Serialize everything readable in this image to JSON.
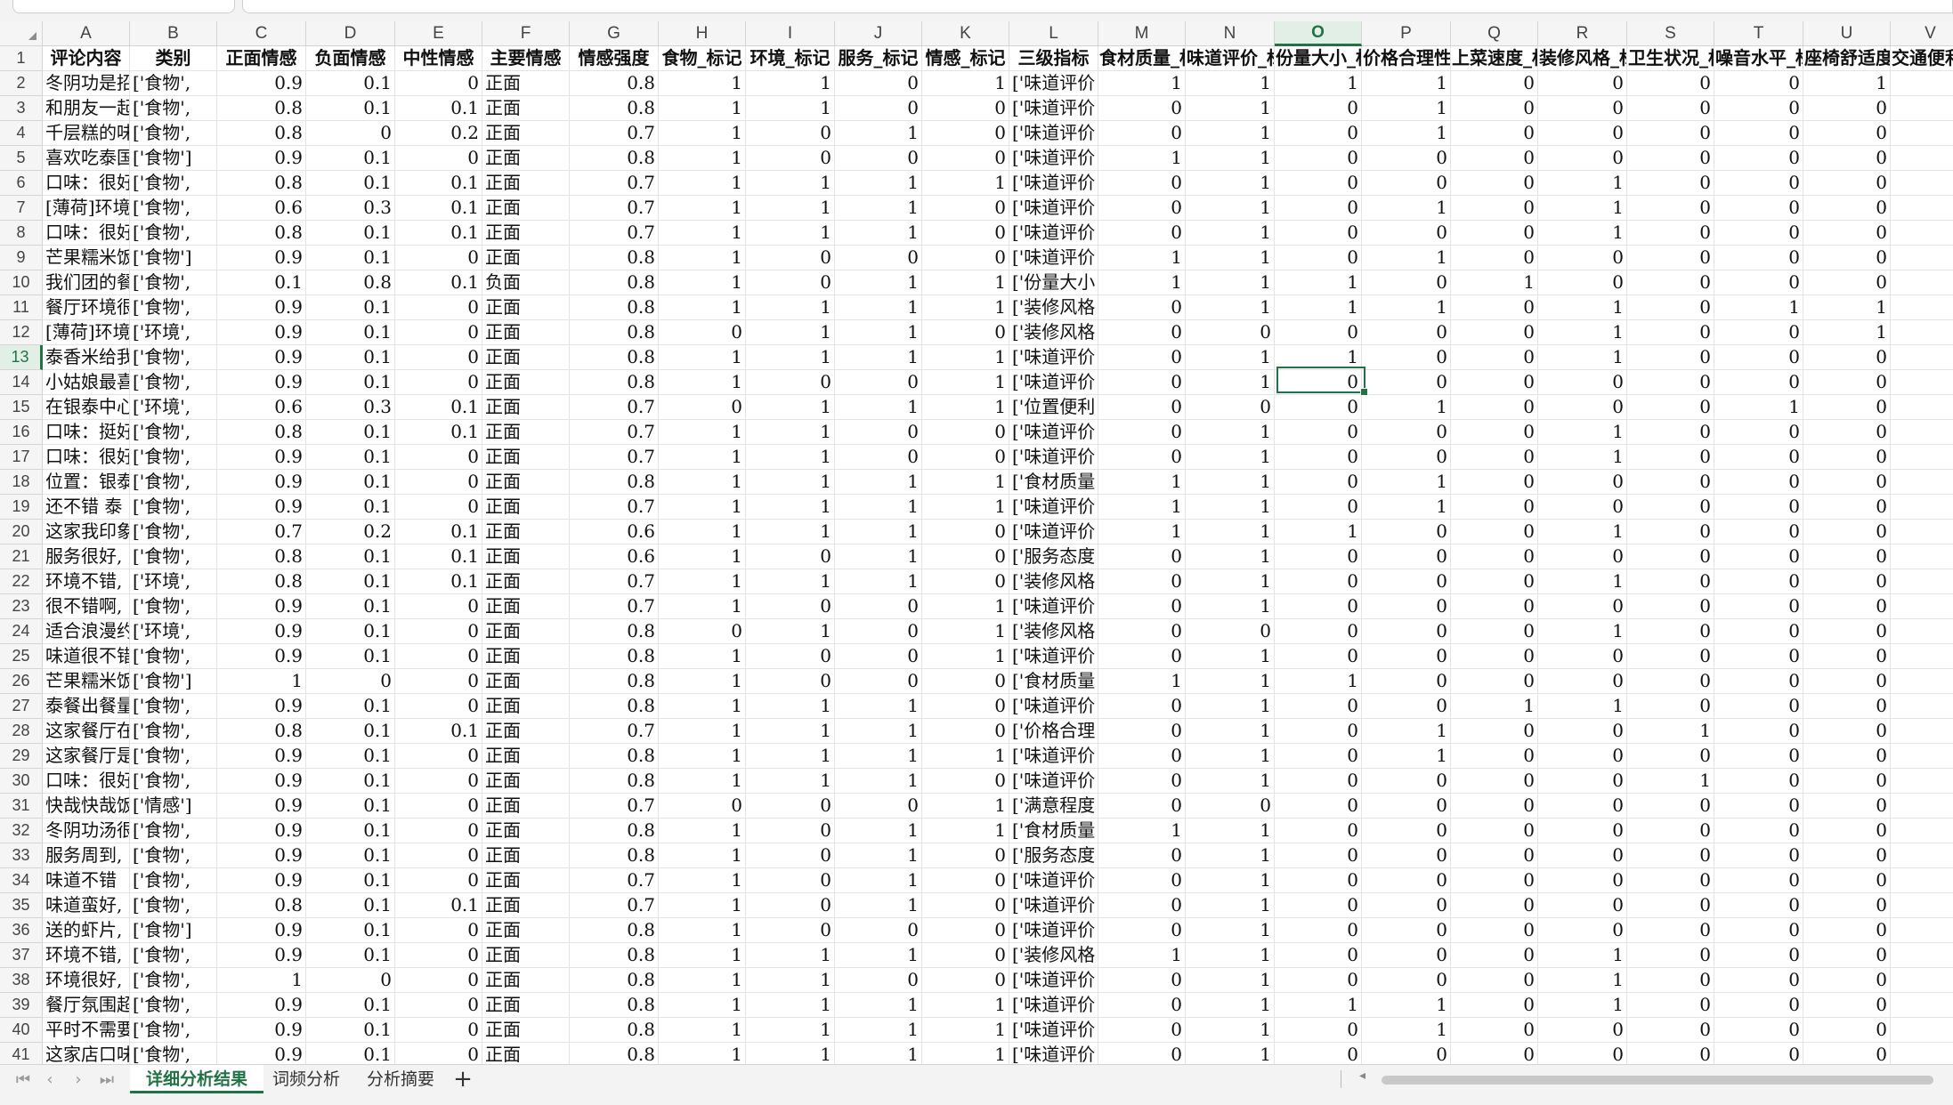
{
  "sheet": {
    "columns": [
      "A",
      "B",
      "C",
      "D",
      "E",
      "F",
      "G",
      "H",
      "I",
      "J",
      "K",
      "L",
      "M",
      "N",
      "O",
      "P",
      "Q",
      "R",
      "S",
      "T",
      "U",
      "V"
    ],
    "selected_column": "O",
    "selected_row": "13",
    "header_row": [
      "评论内容",
      "类别",
      "正面情感",
      "负面情感",
      "中性情感",
      "主要情感",
      "情感强度",
      "食物_标记",
      "环境_标记",
      "服务_标记",
      "情感_标记",
      "三级指标",
      "食材质量_标",
      "味道评价_标",
      "份量大小_标",
      "价格合理性_",
      "上菜速度_标",
      "装修风格_标",
      "卫生状况_标",
      "噪音水平_标",
      "座椅舒适度_",
      "交通便利性"
    ],
    "rows": [
      [
        "1",
        [
          "评论内容",
          "类别",
          "正面情感",
          "负面情感",
          "中性情感",
          "主要情感",
          "情感强度",
          "食物_标记",
          "环境_标记",
          "服务_标记",
          "情感_标记",
          "三级指标",
          "食材质量_标",
          "味道评价_标",
          "份量大小_标",
          "价格合理性_",
          "上菜速度_标",
          "装修风格_标",
          "卫生状况_标",
          "噪音水平_标",
          "座椅舒适度_",
          "交通便利性"
        ]
      ],
      [
        "2",
        [
          "冬阴功是招",
          "['食物',",
          "0.9",
          "0.1",
          "0",
          "正面",
          "0.8",
          "1",
          "1",
          "0",
          "1",
          "['味道评价",
          "1",
          "1",
          "1",
          "1",
          "0",
          "0",
          "0",
          "0",
          "1",
          ""
        ]
      ],
      [
        "3",
        [
          "和朋友一起",
          "['食物',",
          "0.8",
          "0.1",
          "0.1",
          "正面",
          "0.8",
          "1",
          "1",
          "0",
          "0",
          "['味道评价",
          "0",
          "1",
          "0",
          "1",
          "0",
          "0",
          "0",
          "0",
          "0",
          ""
        ]
      ],
      [
        "4",
        [
          "千层糕的味",
          "['食物',",
          "0.8",
          "0",
          "0.2",
          "正面",
          "0.7",
          "1",
          "0",
          "1",
          "0",
          "['味道评价",
          "0",
          "1",
          "0",
          "1",
          "0",
          "0",
          "0",
          "0",
          "0",
          ""
        ]
      ],
      [
        "5",
        [
          "喜欢吃泰国",
          "['食物']",
          "0.9",
          "0.1",
          "0",
          "正面",
          "0.8",
          "1",
          "0",
          "0",
          "0",
          "['味道评价",
          "1",
          "1",
          "0",
          "0",
          "0",
          "0",
          "0",
          "0",
          "0",
          ""
        ]
      ],
      [
        "6",
        [
          "口味：很好",
          "['食物',",
          "0.8",
          "0.1",
          "0.1",
          "正面",
          "0.7",
          "1",
          "1",
          "1",
          "1",
          "['味道评价",
          "0",
          "1",
          "0",
          "0",
          "0",
          "1",
          "0",
          "0",
          "0",
          ""
        ]
      ],
      [
        "7",
        [
          "[薄荷]环境",
          "['食物',",
          "0.6",
          "0.3",
          "0.1",
          "正面",
          "0.7",
          "1",
          "1",
          "1",
          "0",
          "['味道评价",
          "0",
          "1",
          "0",
          "1",
          "0",
          "1",
          "0",
          "0",
          "0",
          ""
        ]
      ],
      [
        "8",
        [
          "口味：很好",
          "['食物',",
          "0.8",
          "0.1",
          "0.1",
          "正面",
          "0.7",
          "1",
          "1",
          "1",
          "0",
          "['味道评价",
          "0",
          "1",
          "0",
          "0",
          "0",
          "1",
          "0",
          "0",
          "0",
          ""
        ]
      ],
      [
        "9",
        [
          "芒果糯米饭",
          "['食物']",
          "0.9",
          "0.1",
          "0",
          "正面",
          "0.8",
          "1",
          "0",
          "0",
          "0",
          "['味道评价",
          "1",
          "1",
          "0",
          "1",
          "0",
          "0",
          "0",
          "0",
          "0",
          ""
        ]
      ],
      [
        "10",
        [
          "我们团的餐",
          "['食物',",
          "0.1",
          "0.8",
          "0.1",
          "负面",
          "0.8",
          "1",
          "0",
          "1",
          "1",
          "['份量大小",
          "1",
          "1",
          "1",
          "0",
          "1",
          "0",
          "0",
          "0",
          "0",
          ""
        ]
      ],
      [
        "11",
        [
          "餐厅环境很",
          "['食物',",
          "0.9",
          "0.1",
          "0",
          "正面",
          "0.8",
          "1",
          "1",
          "1",
          "1",
          "['装修风格",
          "0",
          "1",
          "1",
          "1",
          "0",
          "1",
          "0",
          "1",
          "1",
          ""
        ]
      ],
      [
        "12",
        [
          "[薄荷]环境",
          "['环境',",
          "0.9",
          "0.1",
          "0",
          "正面",
          "0.8",
          "0",
          "1",
          "1",
          "0",
          "['装修风格",
          "0",
          "0",
          "0",
          "0",
          "0",
          "1",
          "0",
          "0",
          "1",
          ""
        ]
      ],
      [
        "13",
        [
          "泰香米给我",
          "['食物',",
          "0.9",
          "0.1",
          "0",
          "正面",
          "0.8",
          "1",
          "1",
          "1",
          "1",
          "['味道评价",
          "0",
          "1",
          "1",
          "0",
          "0",
          "1",
          "0",
          "0",
          "0",
          ""
        ]
      ],
      [
        "14",
        [
          "小姑娘最喜",
          "['食物',",
          "0.9",
          "0.1",
          "0",
          "正面",
          "0.8",
          "1",
          "0",
          "0",
          "1",
          "['味道评价",
          "0",
          "1",
          "0",
          "0",
          "0",
          "0",
          "0",
          "0",
          "0",
          ""
        ]
      ],
      [
        "15",
        [
          "在银泰中心",
          "['环境',",
          "0.6",
          "0.3",
          "0.1",
          "正面",
          "0.7",
          "0",
          "1",
          "1",
          "1",
          "['位置便利",
          "0",
          "0",
          "0",
          "1",
          "0",
          "0",
          "0",
          "1",
          "0",
          ""
        ]
      ],
      [
        "16",
        [
          "口味：挺好",
          "['食物',",
          "0.8",
          "0.1",
          "0.1",
          "正面",
          "0.7",
          "1",
          "1",
          "0",
          "0",
          "['味道评价",
          "0",
          "1",
          "0",
          "0",
          "0",
          "1",
          "0",
          "0",
          "0",
          ""
        ]
      ],
      [
        "17",
        [
          "口味：很好",
          "['食物',",
          "0.9",
          "0.1",
          "0",
          "正面",
          "0.7",
          "1",
          "1",
          "0",
          "0",
          "['味道评价",
          "0",
          "1",
          "0",
          "0",
          "0",
          "1",
          "0",
          "0",
          "0",
          ""
        ]
      ],
      [
        "18",
        [
          "位置：银泰",
          "['食物',",
          "0.9",
          "0.1",
          "0",
          "正面",
          "0.8",
          "1",
          "1",
          "1",
          "1",
          "['食材质量",
          "1",
          "1",
          "0",
          "1",
          "0",
          "0",
          "0",
          "0",
          "0",
          ""
        ]
      ],
      [
        "19",
        [
          "还不错 泰",
          "['食物',",
          "0.9",
          "0.1",
          "0",
          "正面",
          "0.7",
          "1",
          "1",
          "1",
          "1",
          "['味道评价",
          "1",
          "1",
          "0",
          "1",
          "0",
          "0",
          "0",
          "0",
          "0",
          ""
        ]
      ],
      [
        "20",
        [
          "这家我印象",
          "['食物',",
          "0.7",
          "0.2",
          "0.1",
          "正面",
          "0.6",
          "1",
          "1",
          "1",
          "0",
          "['味道评价",
          "1",
          "1",
          "1",
          "0",
          "0",
          "1",
          "0",
          "0",
          "0",
          ""
        ]
      ],
      [
        "21",
        [
          "服务很好,",
          "['食物',",
          "0.8",
          "0.1",
          "0.1",
          "正面",
          "0.6",
          "1",
          "0",
          "1",
          "0",
          "['服务态度",
          "0",
          "1",
          "0",
          "0",
          "0",
          "0",
          "0",
          "0",
          "0",
          ""
        ]
      ],
      [
        "22",
        [
          "环境不错,",
          "['环境',",
          "0.8",
          "0.1",
          "0.1",
          "正面",
          "0.7",
          "1",
          "1",
          "1",
          "0",
          "['装修风格",
          "0",
          "1",
          "0",
          "0",
          "0",
          "1",
          "0",
          "0",
          "0",
          ""
        ]
      ],
      [
        "23",
        [
          "很不错啊,",
          "['食物',",
          "0.9",
          "0.1",
          "0",
          "正面",
          "0.7",
          "1",
          "0",
          "0",
          "1",
          "['味道评价",
          "0",
          "1",
          "0",
          "0",
          "0",
          "0",
          "0",
          "0",
          "0",
          ""
        ]
      ],
      [
        "24",
        [
          "适合浪漫约",
          "['环境',",
          "0.9",
          "0.1",
          "0",
          "正面",
          "0.8",
          "0",
          "1",
          "0",
          "1",
          "['装修风格",
          "0",
          "0",
          "0",
          "0",
          "0",
          "1",
          "0",
          "0",
          "0",
          ""
        ]
      ],
      [
        "25",
        [
          "味道很不错",
          "['食物',",
          "0.9",
          "0.1",
          "0",
          "正面",
          "0.8",
          "1",
          "0",
          "0",
          "1",
          "['味道评价",
          "0",
          "1",
          "0",
          "0",
          "0",
          "0",
          "0",
          "0",
          "0",
          ""
        ]
      ],
      [
        "26",
        [
          "芒果糯米饭",
          "['食物']",
          "1",
          "0",
          "0",
          "正面",
          "0.8",
          "1",
          "0",
          "0",
          "0",
          "['食材质量",
          "1",
          "1",
          "1",
          "0",
          "0",
          "0",
          "0",
          "0",
          "0",
          ""
        ]
      ],
      [
        "27",
        [
          "泰餐出餐量",
          "['食物',",
          "0.9",
          "0.1",
          "0",
          "正面",
          "0.8",
          "1",
          "1",
          "1",
          "0",
          "['味道评价",
          "0",
          "1",
          "0",
          "0",
          "1",
          "1",
          "0",
          "0",
          "0",
          ""
        ]
      ],
      [
        "28",
        [
          "这家餐厅在",
          "['食物',",
          "0.8",
          "0.1",
          "0.1",
          "正面",
          "0.7",
          "1",
          "1",
          "1",
          "0",
          "['价格合理",
          "0",
          "1",
          "0",
          "1",
          "0",
          "0",
          "1",
          "0",
          "0",
          ""
        ]
      ],
      [
        "29",
        [
          "这家餐厅是",
          "['食物',",
          "0.9",
          "0.1",
          "0",
          "正面",
          "0.8",
          "1",
          "1",
          "1",
          "1",
          "['味道评价",
          "0",
          "1",
          "0",
          "1",
          "0",
          "0",
          "0",
          "0",
          "0",
          ""
        ]
      ],
      [
        "30",
        [
          "口味：很好",
          "['食物',",
          "0.9",
          "0.1",
          "0",
          "正面",
          "0.8",
          "1",
          "1",
          "1",
          "0",
          "['味道评价",
          "0",
          "1",
          "0",
          "0",
          "0",
          "0",
          "1",
          "0",
          "0",
          ""
        ]
      ],
      [
        "31",
        [
          "快哉快哉饭",
          "['情感']",
          "0.9",
          "0.1",
          "0",
          "正面",
          "0.7",
          "0",
          "0",
          "0",
          "1",
          "['满意程度",
          "0",
          "0",
          "0",
          "0",
          "0",
          "0",
          "0",
          "0",
          "0",
          ""
        ]
      ],
      [
        "32",
        [
          "冬阴功汤很",
          "['食物',",
          "0.9",
          "0.1",
          "0",
          "正面",
          "0.8",
          "1",
          "0",
          "1",
          "1",
          "['食材质量",
          "1",
          "1",
          "0",
          "0",
          "0",
          "0",
          "0",
          "0",
          "0",
          ""
        ]
      ],
      [
        "33",
        [
          "服务周到,",
          "['食物',",
          "0.9",
          "0.1",
          "0",
          "正面",
          "0.8",
          "1",
          "0",
          "1",
          "0",
          "['服务态度",
          "0",
          "1",
          "0",
          "0",
          "0",
          "0",
          "0",
          "0",
          "0",
          ""
        ]
      ],
      [
        "34",
        [
          "味道不错 ",
          "['食物',",
          "0.9",
          "0.1",
          "0",
          "正面",
          "0.7",
          "1",
          "0",
          "1",
          "0",
          "['味道评价",
          "0",
          "1",
          "0",
          "0",
          "0",
          "0",
          "0",
          "0",
          "0",
          ""
        ]
      ],
      [
        "35",
        [
          "味道蛮好,",
          "['食物',",
          "0.8",
          "0.1",
          "0.1",
          "正面",
          "0.7",
          "1",
          "0",
          "1",
          "0",
          "['味道评价",
          "0",
          "1",
          "0",
          "0",
          "0",
          "0",
          "0",
          "0",
          "0",
          ""
        ]
      ],
      [
        "36",
        [
          "送的虾片,",
          "['食物']",
          "0.9",
          "0.1",
          "0",
          "正面",
          "0.8",
          "1",
          "0",
          "0",
          "0",
          "['味道评价",
          "0",
          "1",
          "0",
          "0",
          "0",
          "0",
          "0",
          "0",
          "0",
          ""
        ]
      ],
      [
        "37",
        [
          "环境不错,",
          "['食物',",
          "0.9",
          "0.1",
          "0",
          "正面",
          "0.8",
          "1",
          "1",
          "1",
          "0",
          "['装修风格",
          "1",
          "1",
          "0",
          "0",
          "0",
          "1",
          "0",
          "0",
          "0",
          ""
        ]
      ],
      [
        "38",
        [
          "环境很好,",
          "['食物',",
          "1",
          "0",
          "0",
          "正面",
          "0.8",
          "1",
          "1",
          "0",
          "0",
          "['味道评价",
          "0",
          "1",
          "0",
          "0",
          "0",
          "1",
          "0",
          "0",
          "0",
          ""
        ]
      ],
      [
        "39",
        [
          "餐厅氛围超",
          "['食物',",
          "0.9",
          "0.1",
          "0",
          "正面",
          "0.8",
          "1",
          "1",
          "1",
          "1",
          "['味道评价",
          "0",
          "1",
          "1",
          "1",
          "0",
          "1",
          "0",
          "0",
          "0",
          ""
        ]
      ],
      [
        "40",
        [
          "平时不需要",
          "['食物',",
          "0.9",
          "0.1",
          "0",
          "正面",
          "0.8",
          "1",
          "1",
          "1",
          "1",
          "['味道评价",
          "0",
          "1",
          "0",
          "1",
          "0",
          "0",
          "0",
          "0",
          "0",
          ""
        ]
      ],
      [
        "41",
        [
          "这家店口味",
          "['食物',",
          "0.9",
          "0.1",
          "0",
          "正面",
          "0.8",
          "1",
          "1",
          "1",
          "1",
          "['味道评价",
          "0",
          "1",
          "0",
          "0",
          "0",
          "0",
          "0",
          "0",
          "0",
          ""
        ]
      ]
    ]
  },
  "tabs": [
    {
      "label": "详细分析结果",
      "active": true
    },
    {
      "label": "词频分析",
      "active": false
    },
    {
      "label": "分析摘要",
      "active": false
    }
  ],
  "add_sheet_label": "+",
  "icons": {
    "first": "first-sheet-icon",
    "prev": "prev-sheet-icon",
    "next": "next-sheet-icon",
    "last": "last-sheet-icon"
  },
  "colors": {
    "accent": "#217346",
    "selected_header_bg": "#e1efe6"
  }
}
